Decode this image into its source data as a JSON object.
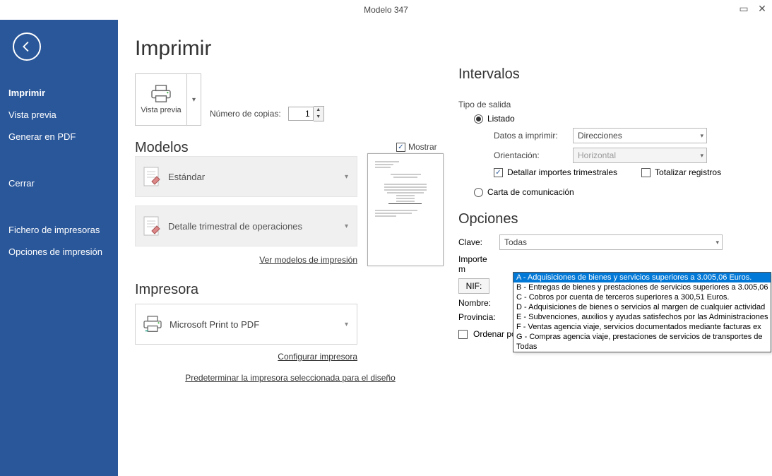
{
  "window": {
    "title": "Modelo 347"
  },
  "sidebar": {
    "items": [
      "Imprimir",
      "Vista previa",
      "Generar en PDF",
      "Cerrar",
      "Fichero de impresoras",
      "Opciones de impresión"
    ]
  },
  "page": {
    "title": "Imprimir",
    "preview_label": "Vista previa",
    "copies_label": "Número de copias:",
    "copies_value": "1"
  },
  "modelos": {
    "heading": "Modelos",
    "mostrar": "Mostrar",
    "items": [
      "Estándar",
      "Detalle trimestral de operaciones"
    ],
    "view_link": "Ver modelos de impresión"
  },
  "impresora": {
    "heading": "Impresora",
    "name": "Microsoft Print to PDF",
    "config_link": "Configurar impresora",
    "default_link": "Predeterminar la impresora seleccionada para el diseño"
  },
  "intervalos": {
    "heading": "Intervalos",
    "tipo_salida": "Tipo de salida",
    "listado": "Listado",
    "datos_imprimir": "Datos a imprimir:",
    "datos_value": "Direcciones",
    "orientacion": "Orientación:",
    "orientacion_value": "Horizontal",
    "detallar": "Detallar importes trimestrales",
    "totalizar": "Totalizar registros",
    "carta": "Carta de comunicación"
  },
  "opciones": {
    "heading": "Opciones",
    "clave_label": "Clave:",
    "clave_value": "Todas",
    "importe_label": "Importe m",
    "nif_label": "NIF:",
    "nombre_label": "Nombre:",
    "provincia_label": "Provincia:",
    "ordenar": "Ordenar por nombre del declarado",
    "dropdown": [
      "A - Adquisiciones de bienes y servicios superiores a 3.005,06 Euros.",
      "B - Entregas de bienes y prestaciones de servicios superiores a 3.005,06",
      "C - Cobros por cuenta de terceros superiores a 300,51 Euros.",
      "D - Adquisiciones de bienes o servicios al margen de cualquier actividad",
      "E - Subvenciones, auxilios y ayudas satisfechos por las Administraciones",
      "F - Ventas agencia viaje, servicios documentados mediante facturas ex",
      "G - Compras agencia viaje, prestaciones de servicios de transportes de",
      "Todas"
    ]
  }
}
